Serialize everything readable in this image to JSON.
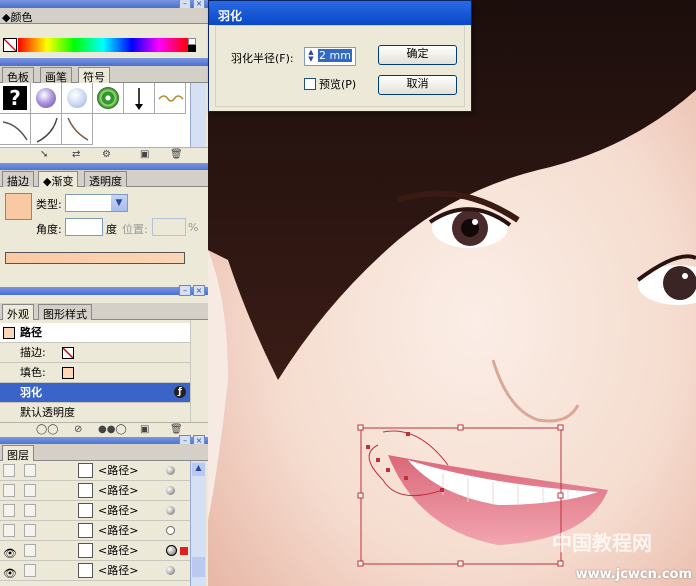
{
  "color_panel": {
    "title": "颜色"
  },
  "symbols_panel": {
    "tabs": [
      "色板",
      "画笔",
      "符号"
    ]
  },
  "gradient_panel": {
    "tabs": [
      "描边",
      "渐变",
      "透明度"
    ],
    "type_label": "类型:",
    "angle_label": "角度:",
    "degree_unit": "度",
    "position_label": "位置:",
    "percent_unit": "%"
  },
  "appearance_panel": {
    "tabs": [
      "外观",
      "图形样式"
    ],
    "object": "路径",
    "stroke_label": "描边:",
    "fill_label": "填色:",
    "effect": "羽化",
    "opacity": "默认透明度"
  },
  "layers_panel": {
    "tab": "图层",
    "rows": [
      "<路径>",
      "<路径>",
      "<路径>",
      "<路径>",
      "<路径>",
      "<路径>"
    ]
  },
  "dialog": {
    "title": "羽化",
    "radius_label": "羽化半径(F):",
    "radius_value": "2 mm",
    "preview_label": "预览(P)",
    "ok": "确定",
    "cancel": "取消"
  },
  "watermark": {
    "line1": "中国教程网",
    "line2": "www.jcwcn.com"
  },
  "colors": {
    "selection": "#3a64c8",
    "gradient_start": "#f9c9a4",
    "dialog_title": "#0a48c8"
  }
}
